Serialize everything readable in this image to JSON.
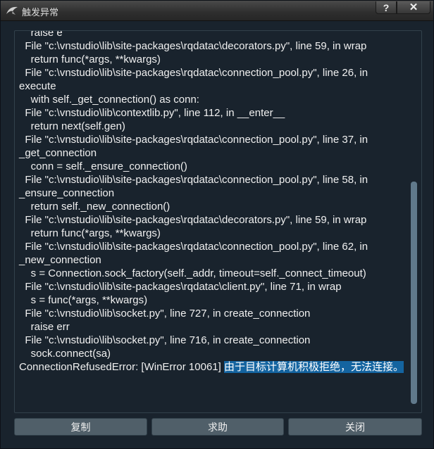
{
  "window": {
    "title": "触发异常",
    "help_label": "?",
    "close_label": "✕",
    "icon": "app-logo-icon"
  },
  "trace": {
    "lines": [
      "    raise e",
      "  File \"c:\\vnstudio\\lib\\site-packages\\rqdatac\\decorators.py\", line 59, in wrap",
      "    return func(*args, **kwargs)",
      "  File \"c:\\vnstudio\\lib\\site-packages\\rqdatac\\connection_pool.py\", line 26, in",
      "execute",
      "    with self._get_connection() as conn:",
      "  File \"c:\\vnstudio\\lib\\contextlib.py\", line 112, in __enter__",
      "    return next(self.gen)",
      "  File \"c:\\vnstudio\\lib\\site-packages\\rqdatac\\connection_pool.py\", line 37, in",
      "_get_connection",
      "    conn = self._ensure_connection()",
      "  File \"c:\\vnstudio\\lib\\site-packages\\rqdatac\\connection_pool.py\", line 58, in",
      "_ensure_connection",
      "    return self._new_connection()",
      "  File \"c:\\vnstudio\\lib\\site-packages\\rqdatac\\decorators.py\", line 59, in wrap",
      "    return func(*args, **kwargs)",
      "  File \"c:\\vnstudio\\lib\\site-packages\\rqdatac\\connection_pool.py\", line 62, in",
      "_new_connection",
      "    s = Connection.sock_factory(self._addr, timeout=self._connect_timeout)",
      "  File \"c:\\vnstudio\\lib\\site-packages\\rqdatac\\client.py\", line 71, in wrap",
      "    s = func(*args, **kwargs)",
      "  File \"c:\\vnstudio\\lib\\socket.py\", line 727, in create_connection",
      "    raise err",
      "  File \"c:\\vnstudio\\lib\\socket.py\", line 716, in create_connection",
      "    sock.connect(sa)"
    ],
    "error_prefix": "ConnectionRefusedError: [WinError 10061] ",
    "error_selected": "由于目标计算机积极拒绝，无法连接。"
  },
  "buttons": {
    "copy": "复制",
    "help": "求助",
    "close": "关闭"
  },
  "colors": {
    "background": "#19232d",
    "text": "#f0f0f0",
    "selection": "#1464a0",
    "button": "#505f69",
    "scroll_thumb": "#60798b"
  }
}
